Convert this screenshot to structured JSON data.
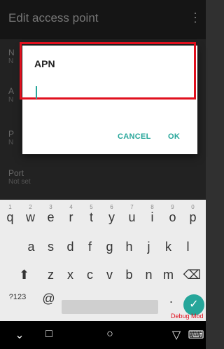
{
  "appbar": {
    "title": "Edit access point",
    "more_icon": "⋮"
  },
  "prefs": [
    {
      "title": "N",
      "summary": "N"
    },
    {
      "title": "A",
      "summary": "N"
    },
    {
      "title": "P",
      "summary": "N"
    },
    {
      "title": "Port",
      "summary": "Not set"
    }
  ],
  "dialog": {
    "title": "APN",
    "value": "",
    "cancel_label": "CANCEL",
    "ok_label": "OK"
  },
  "keyboard": {
    "row1": [
      "q",
      "w",
      "e",
      "r",
      "t",
      "y",
      "u",
      "i",
      "o",
      "p"
    ],
    "row1_hints": [
      "1",
      "2",
      "3",
      "4",
      "5",
      "6",
      "7",
      "8",
      "9",
      "0"
    ],
    "row2": [
      "a",
      "s",
      "d",
      "f",
      "g",
      "h",
      "j",
      "k",
      "l"
    ],
    "row3": [
      "z",
      "x",
      "c",
      "v",
      "b",
      "n",
      "m"
    ],
    "symbols_label": "?123",
    "at_label": "@",
    "period_label": ".",
    "shift_icon": "⬆",
    "delete_icon": "⌫",
    "enter_icon": "✓"
  },
  "debug_label": "Debug Mod",
  "navbar": {
    "down_icon": "⌄",
    "recents_icon": "□",
    "home_icon": "○",
    "back_icon": "▽",
    "keyboard_icon": "⌨"
  },
  "colors": {
    "accent": "#26a69a",
    "highlight": "#e0101e"
  }
}
